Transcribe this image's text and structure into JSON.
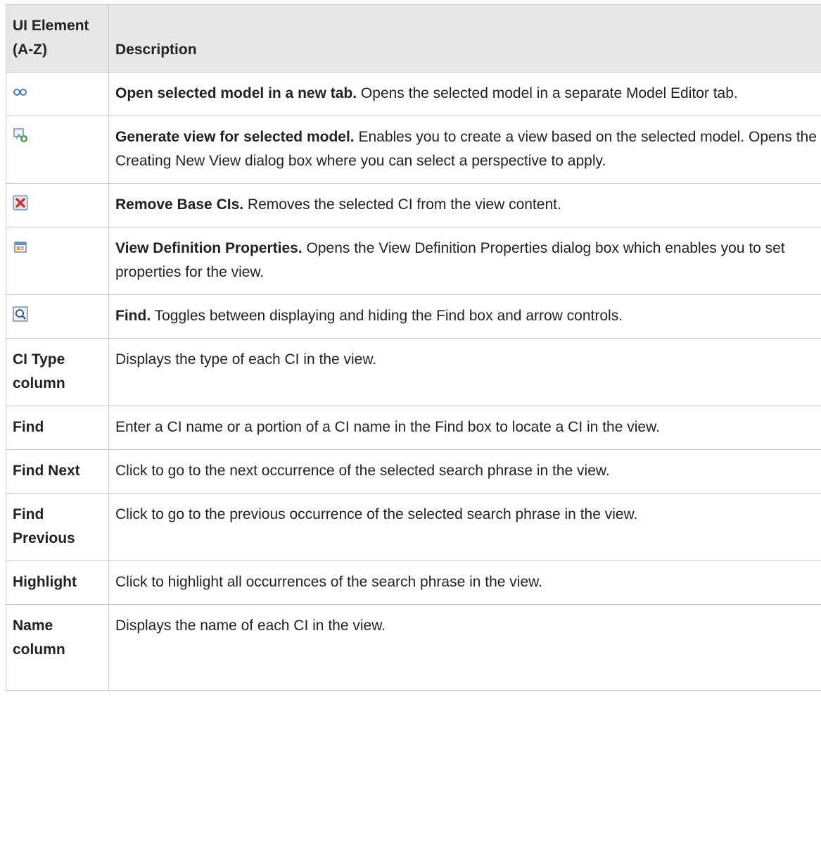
{
  "header": {
    "col1": "UI Element (A-Z)",
    "col2": "Description"
  },
  "icon_rows": [
    {
      "icon": "open-in-new-tab-icon",
      "title": "Open selected model in a new tab.",
      "text": " Opens the selected model in a separate Model Editor tab."
    },
    {
      "icon": "generate-view-icon",
      "title": "Generate view for selected model.",
      "text": " Enables you to create a view based on the selected model. Opens the Creating New View dialog box where you can select a perspective to apply."
    },
    {
      "icon": "remove-icon",
      "title": "Remove Base CIs.",
      "text": " Removes the selected CI from the view content."
    },
    {
      "icon": "properties-icon",
      "title": "View Definition Properties.",
      "text": " Opens the View Definition Properties dialog box which enables you to set properties for the view."
    },
    {
      "icon": "find-icon",
      "title": "Find.",
      "text": " Toggles between displaying and hiding the Find box and arrow controls."
    }
  ],
  "text_rows": [
    {
      "element": "CI Type column",
      "description": "Displays the type of each CI in the view."
    },
    {
      "element": "Find",
      "description": "Enter a CI name or a portion of a CI name in the Find box to locate a CI in the view."
    },
    {
      "element": "Find Next",
      "description": "Click to go to the next occurrence of the selected search phrase in the view."
    },
    {
      "element": "Find Previous",
      "description": "Click to go to the previous occurrence of the selected search phrase in the view."
    },
    {
      "element": "Highlight",
      "description": "Click to highlight all occurrences of the search phrase in the view."
    },
    {
      "element": "Name column",
      "description": "Displays the name of each CI in the view."
    }
  ]
}
